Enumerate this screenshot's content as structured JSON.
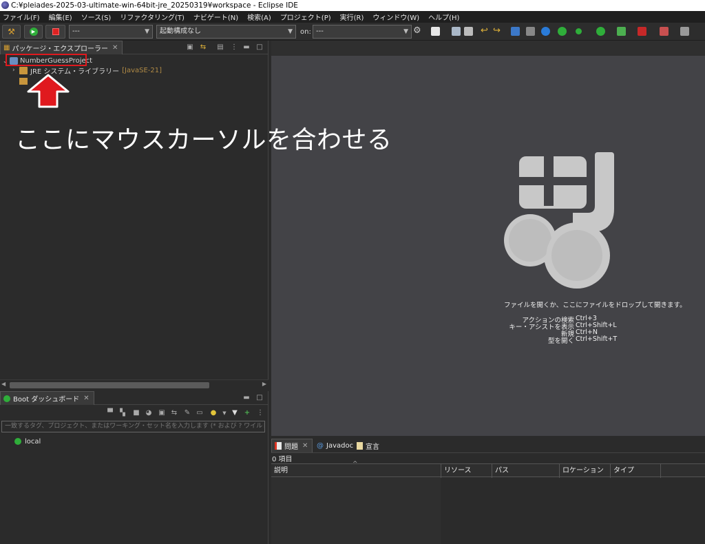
{
  "window": {
    "title": "C:¥pleiades-2025-03-ultimate-win-64bit-jre_20250319¥workspace - Eclipse IDE"
  },
  "menu": [
    "ファイル(F)",
    "編集(E)",
    "ソース(S)",
    "リファクタリング(T)",
    "ナビゲート(N)",
    "検索(A)",
    "プロジェクト(P)",
    "実行(R)",
    "ウィンドウ(W)",
    "ヘルプ(H)"
  ],
  "toolbar": {
    "launch_mode_value": "---",
    "launch_config_value": "起動構成なし",
    "on_label": "on:",
    "target_value": "---"
  },
  "package_explorer": {
    "tab_label": "パッケージ・エクスプローラー",
    "project_name": "NumberGuessProject",
    "jre_label": "JRE システム・ライブラリー",
    "jre_version": "[JavaSE-21]"
  },
  "boot_dashboard": {
    "tab_label": "Boot ダッシュボード",
    "filter_placeholder": "一致するタグ、プロジェクト、またはワーキング・セット名を入力します (* および ? ワイルドカードを使用)",
    "local_label": "local"
  },
  "editor_hints": {
    "open_file": "ファイルを開くか、ここにファイルをドロップして開きます。",
    "shortcuts": [
      {
        "label": "アクションの検索",
        "keys": "Ctrl+3"
      },
      {
        "label": "キー・アシストを表示",
        "keys": "Ctrl+Shift+L"
      },
      {
        "label": "新規",
        "keys": "Ctrl+N"
      },
      {
        "label": "型を開く",
        "keys": "Ctrl+Shift+T"
      }
    ]
  },
  "problems": {
    "tabs": [
      "問題",
      "Javadoc",
      "宣言"
    ],
    "count": "0 項目",
    "columns": [
      "説明",
      "リソース",
      "パス",
      "ロケーション",
      "タイプ"
    ]
  },
  "annotation": {
    "text": "ここにマウスカーソルを合わせる"
  },
  "colors": {
    "highlight_red": "#e0191e",
    "editor_bg": "#434347",
    "logo_gray": "#c8c8c8"
  }
}
